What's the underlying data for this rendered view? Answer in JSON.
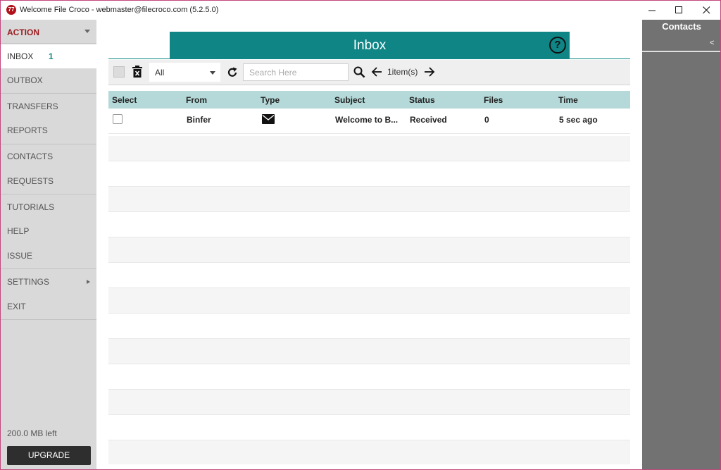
{
  "window": {
    "logo_text": "77",
    "title": "Welcome  File Croco - webmaster@filecroco.com (5.2.5.0)",
    "min": "—",
    "max": "☐",
    "close": "✕"
  },
  "sidebar": {
    "action_label": "ACTION",
    "items": [
      {
        "label": "INBOX",
        "count": "1"
      },
      {
        "label": "OUTBOX"
      },
      {
        "label": "TRANSFERS"
      },
      {
        "label": "REPORTS"
      },
      {
        "label": "CONTACTS"
      },
      {
        "label": "REQUESTS"
      },
      {
        "label": "TUTORIALS"
      },
      {
        "label": "HELP"
      },
      {
        "label": "ISSUE"
      },
      {
        "label": "SETTINGS"
      },
      {
        "label": "EXIT"
      }
    ],
    "storage": "200.0 MB left",
    "upgrade_label": "UPGRADE"
  },
  "main": {
    "title": "Inbox",
    "help_symbol": "?",
    "filter_value": "All",
    "search_placeholder": "Search Here",
    "item_count": "1item(s)",
    "columns": [
      "Select",
      "From",
      "Type",
      "Subject",
      "Status",
      "Files",
      "Time"
    ],
    "rows": [
      {
        "from": "Binfer",
        "type": "mail-icon",
        "subject": "Welcome to B...",
        "status": "Received",
        "files": "0",
        "time": "5 sec ago"
      }
    ]
  },
  "right_panel": {
    "title": "Contacts",
    "collapse": "<"
  },
  "colors": {
    "accent_teal": "#0f8585",
    "header_teal_light": "#b5d9d9",
    "action_red": "#9c1b1f",
    "sidebar_bg": "#d9d9d9",
    "right_panel_bg": "#727272"
  }
}
